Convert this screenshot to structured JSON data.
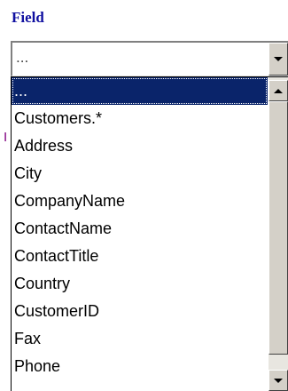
{
  "field_label": "Field",
  "combo": {
    "value": "..."
  },
  "behind_text": "I",
  "dropdown": {
    "items": [
      "...",
      "Customers.*",
      "Address",
      "City",
      "CompanyName",
      "ContactName",
      "ContactTitle",
      "Country",
      "CustomerID",
      "Fax",
      "Phone"
    ],
    "selected_index": 0
  },
  "colors": {
    "label": "#1010a0",
    "selection": "#0a246a",
    "button_face": "#d4d0c8"
  },
  "icons": {
    "combo_button": "chevron-down-icon",
    "scroll_up": "arrow-up-icon",
    "scroll_down": "arrow-down-icon"
  }
}
